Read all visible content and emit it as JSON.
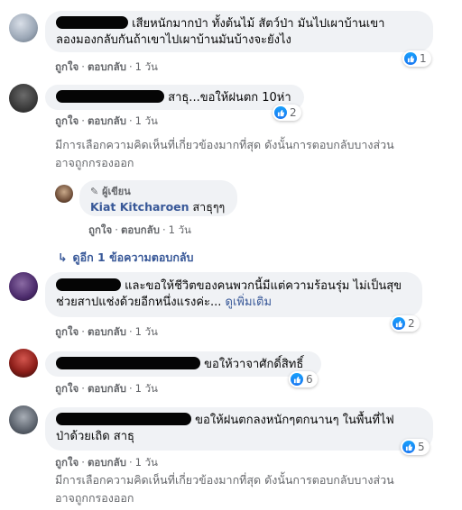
{
  "comments": [
    {
      "text": "เสียหนักมากป่า ทั้งต้นไม้ สัตว์ป่า มันไปเผาบ้านเขาลองมองกลับกันถ้าเขาไปเผาบ้านมันบ้างจะยังไง",
      "text_line1": "เสียหนักมากป่า ทั้งต้นไม้ สัตว์ป่า มันไปเผาบ้านเขา",
      "text_line2": "ลองมองกลับกันถ้าเขาไปเผาบ้านมันบ้างจะยังไง",
      "likes": "1",
      "like_label": "ถูกใจ",
      "reply_label": "ตอบกลับ",
      "time": "1 วัน"
    },
    {
      "text": "สาธุ...ขอให้ฝนตก 10ห่า",
      "likes": "2",
      "like_label": "ถูกใจ",
      "reply_label": "ตอบกลับ",
      "time": "1 วัน",
      "filter_note_line1": "มีการเลือกความคิดเห็นที่เกี่ยวข้องมากที่สุด ดังนั้นการตอบกลับบางส่วน",
      "filter_note_line2": "อาจถูกกรองออก"
    },
    {
      "text_line1": "และขอให้ชีวิตของคนพวกนี้มีแต่ความร้อนรุ่ม ไม่เป็นสุข",
      "text_line2": "ช่วยสาปแช่งด้วยอีกหนึ่งแรงค่ะ...",
      "see_more": "ดูเพิ่มเติม",
      "likes": "2",
      "like_label": "ถูกใจ",
      "reply_label": "ตอบกลับ",
      "time": "1 วัน"
    },
    {
      "text": "ขอให้วาจาศักดิ์สิทธิ์",
      "likes": "6",
      "like_label": "ถูกใจ",
      "reply_label": "ตอบกลับ",
      "time": "1 วัน"
    },
    {
      "text_line1": "ขอให้ฝนตกลงหนักๆตกนานๆ ในพื้นที่ไฟ",
      "text_line2": "ป่าด้วยเถิด สาธุ",
      "likes": "5",
      "like_label": "ถูกใจ",
      "reply_label": "ตอบกลับ",
      "time": "1 วัน",
      "filter_note_line1": "มีการเลือกความคิดเห็นที่เกี่ยวข้องมากที่สุด ดังนั้นการตอบกลับบางส่วน",
      "filter_note_line2": "อาจถูกกรองออก"
    }
  ],
  "author_reply": {
    "badge": "ผู้เขียน",
    "name": "Kiat Kitcharoen",
    "text": "สาธุๆๆ",
    "like_label": "ถูกใจ",
    "reply_label": "ตอบกลับ",
    "time": "1 วัน"
  },
  "view_more_replies": "ดูอีก 1 ข้อความตอบกลับ",
  "colors": {
    "bubble": "#f0f2f5",
    "link": "#385898",
    "meta": "#65676b",
    "like": "#1877f2"
  }
}
